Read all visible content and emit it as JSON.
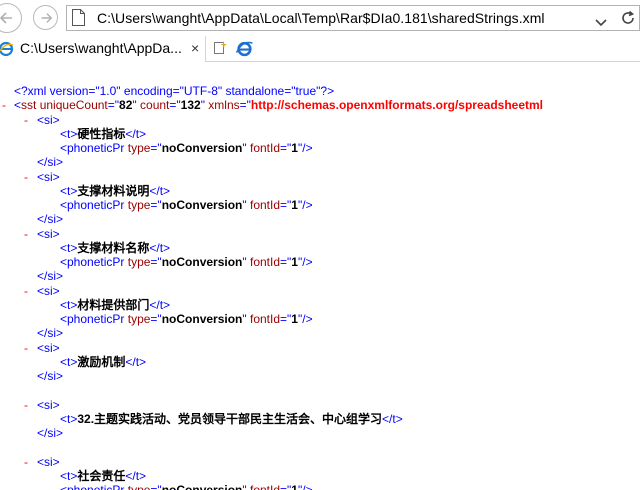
{
  "address": {
    "url": "C:\\Users\\wanght\\AppData\\Local\\Temp\\Rar$DIa0.181\\sharedStrings.xml"
  },
  "tab": {
    "title": "C:\\Users\\wanght\\AppDa...",
    "close": "×"
  },
  "xml": {
    "pi": "<?xml version=\"1.0\" encoding=\"UTF-8\" standalone=\"true\"?>",
    "minus": "-",
    "sst": {
      "open": "<",
      "name": "sst",
      "attr1_name": "uniqueCount",
      "attr1_value": "82",
      "attr2_name": "count",
      "attr2_value": "132",
      "attr3_name": "xmlns",
      "attr3_value": "http://schemas.openxmlformats.org/spreadsheetml"
    },
    "si_open": "<si>",
    "si_close": "</si>",
    "t_open": "<t>",
    "t_close": "</t>",
    "phonetic": {
      "open": "<phoneticPr",
      "type_name": "type",
      "type_value": "noConversion",
      "font_name": "fontId",
      "font_value": "1",
      "close": "/>"
    },
    "items": [
      {
        "text": "硬性指标"
      },
      {
        "text": "支撑材料说明"
      },
      {
        "text": "支撑材料名称"
      },
      {
        "text": "材料提供部门"
      },
      {
        "text": "激励机制"
      },
      {
        "text": "32.主题实践活动、党员领导干部民主生活会、中心组学习"
      },
      {
        "text": "社会责任"
      }
    ]
  }
}
